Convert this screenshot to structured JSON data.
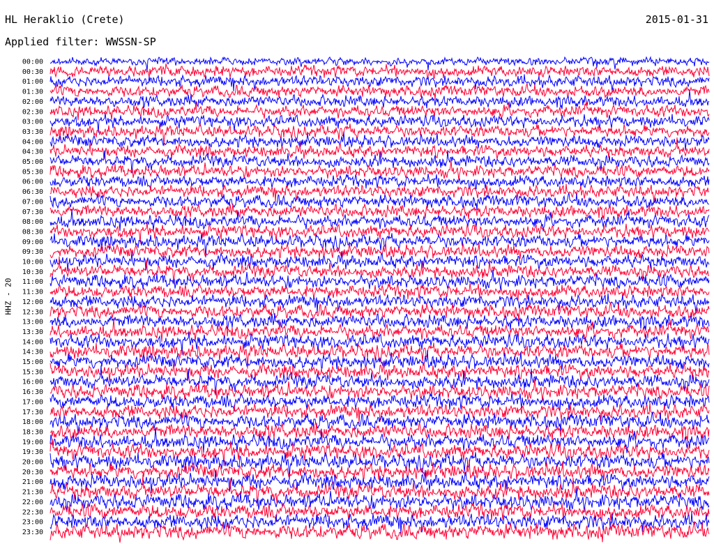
{
  "header": {
    "station": "HL Heraklio (Crete)",
    "date": "2015-01-31",
    "filter": "Applied filter: WWSSN-SP"
  },
  "chart_data": {
    "type": "line",
    "title": "HL Heraklio (Crete)",
    "ylabel": "HHZ - 20",
    "xlabel": "",
    "rows": [
      "00:00",
      "00:30",
      "01:00",
      "01:30",
      "02:00",
      "02:30",
      "03:00",
      "03:30",
      "04:00",
      "04:30",
      "05:00",
      "05:30",
      "06:00",
      "06:30",
      "07:00",
      "07:30",
      "08:00",
      "08:30",
      "09:00",
      "09:30",
      "10:00",
      "10:30",
      "11:00",
      "11:30",
      "12:00",
      "12:30",
      "13:00",
      "13:30",
      "14:00",
      "14:30",
      "15:00",
      "15:30",
      "16:00",
      "16:30",
      "17:00",
      "17:30",
      "18:00",
      "18:30",
      "19:00",
      "19:30",
      "20:00",
      "20:30",
      "21:00",
      "21:30",
      "22:00",
      "22:30",
      "23:00",
      "23:30"
    ],
    "series_colors": [
      "#0000ff",
      "#ff0033"
    ],
    "grid": false
  }
}
